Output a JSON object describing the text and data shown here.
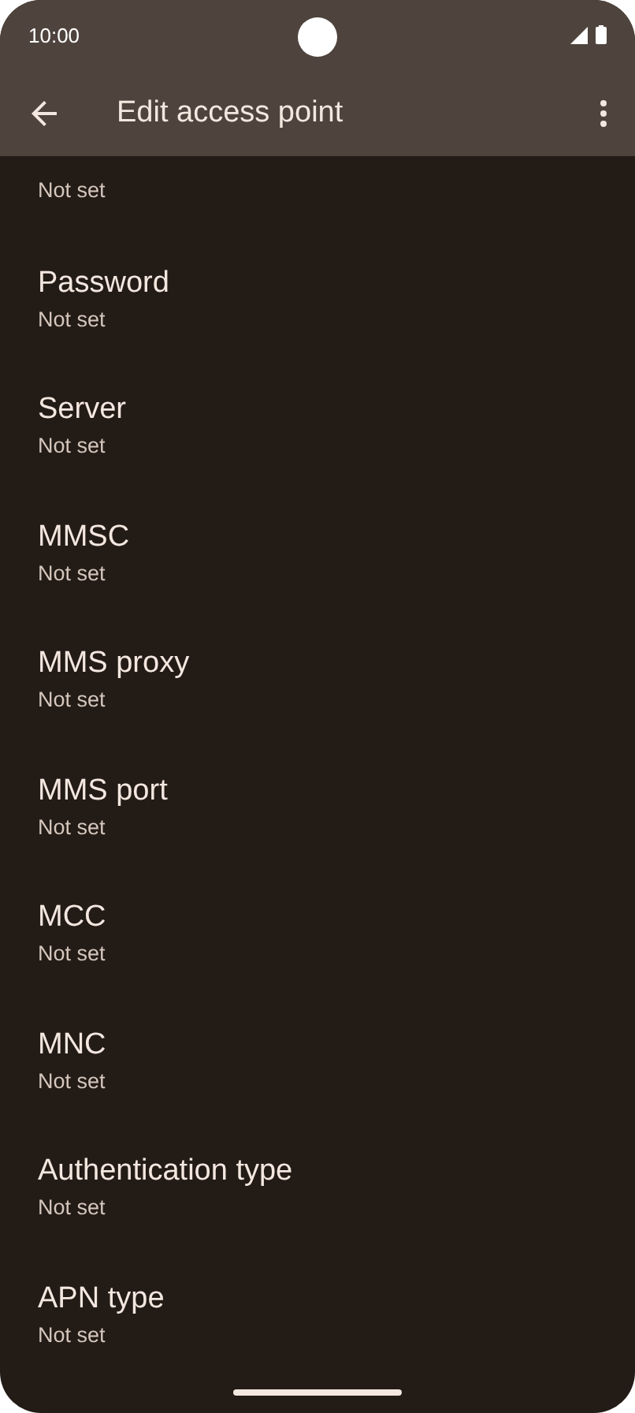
{
  "status_bar": {
    "time": "10:00"
  },
  "app_bar": {
    "title": "Edit access point"
  },
  "preferences": [
    {
      "summary": "Not set"
    },
    {
      "title": "Password",
      "summary": "Not set"
    },
    {
      "title": "Server",
      "summary": "Not set"
    },
    {
      "title": "MMSC",
      "summary": "Not set"
    },
    {
      "title": "MMS proxy",
      "summary": "Not set"
    },
    {
      "title": "MMS port",
      "summary": "Not set"
    },
    {
      "title": "MCC",
      "summary": "Not set"
    },
    {
      "title": "MNC",
      "summary": "Not set"
    },
    {
      "title": "Authentication type",
      "summary": "Not set"
    },
    {
      "title": "APN type",
      "summary": "Not set"
    }
  ]
}
